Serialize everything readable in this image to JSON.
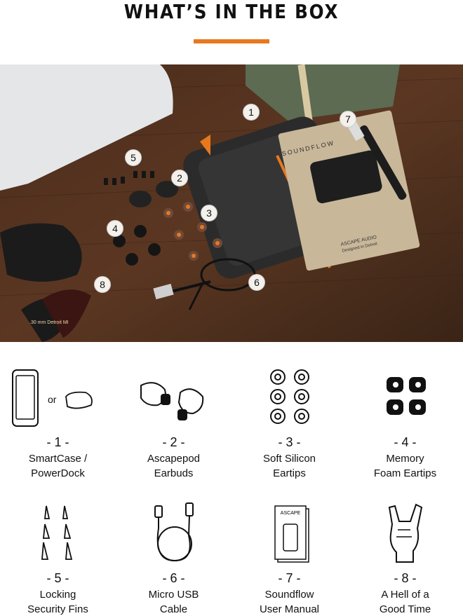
{
  "header": {
    "title": "WHAT’S IN THE BOX",
    "accent_color": "#e8781e"
  },
  "photo": {
    "badges": [
      "1",
      "2",
      "3",
      "4",
      "5",
      "6",
      "7",
      "8"
    ],
    "manual_card_text": "SOUNDFLOW",
    "manual_brand_text": "ASCAPE AUDIO",
    "manual_sub_text": "Designed in Detroit",
    "picks_text": ".30 mm Detroit MI"
  },
  "items": [
    {
      "number": "- 1 -",
      "line1": "SmartCase /",
      "line2": "PowerDock",
      "icon": "phone-case-icon",
      "or_text": "or"
    },
    {
      "number": "- 2 -",
      "line1": "Ascapepod",
      "line2": "Earbuds",
      "icon": "earbuds-icon"
    },
    {
      "number": "- 3 -",
      "line1": "Soft Silicon",
      "line2": "Eartips",
      "icon": "silicon-eartips-icon"
    },
    {
      "number": "- 4 -",
      "line1": "Memory",
      "line2": "Foam Eartips",
      "icon": "foam-eartips-icon"
    },
    {
      "number": "- 5 -",
      "line1": "Locking",
      "line2": "Security Fins",
      "icon": "security-fins-icon"
    },
    {
      "number": "- 6 -",
      "line1": "Micro USB",
      "line2": "Cable",
      "icon": "usb-cable-icon"
    },
    {
      "number": "- 7 -",
      "line1": "Soundflow",
      "line2": "User Manual",
      "icon": "user-manual-icon",
      "manual_brand": "ASCAPE"
    },
    {
      "number": "- 8 -",
      "line1": "A Hell of a",
      "line2": "Good Time",
      "icon": "rock-hand-icon"
    }
  ]
}
